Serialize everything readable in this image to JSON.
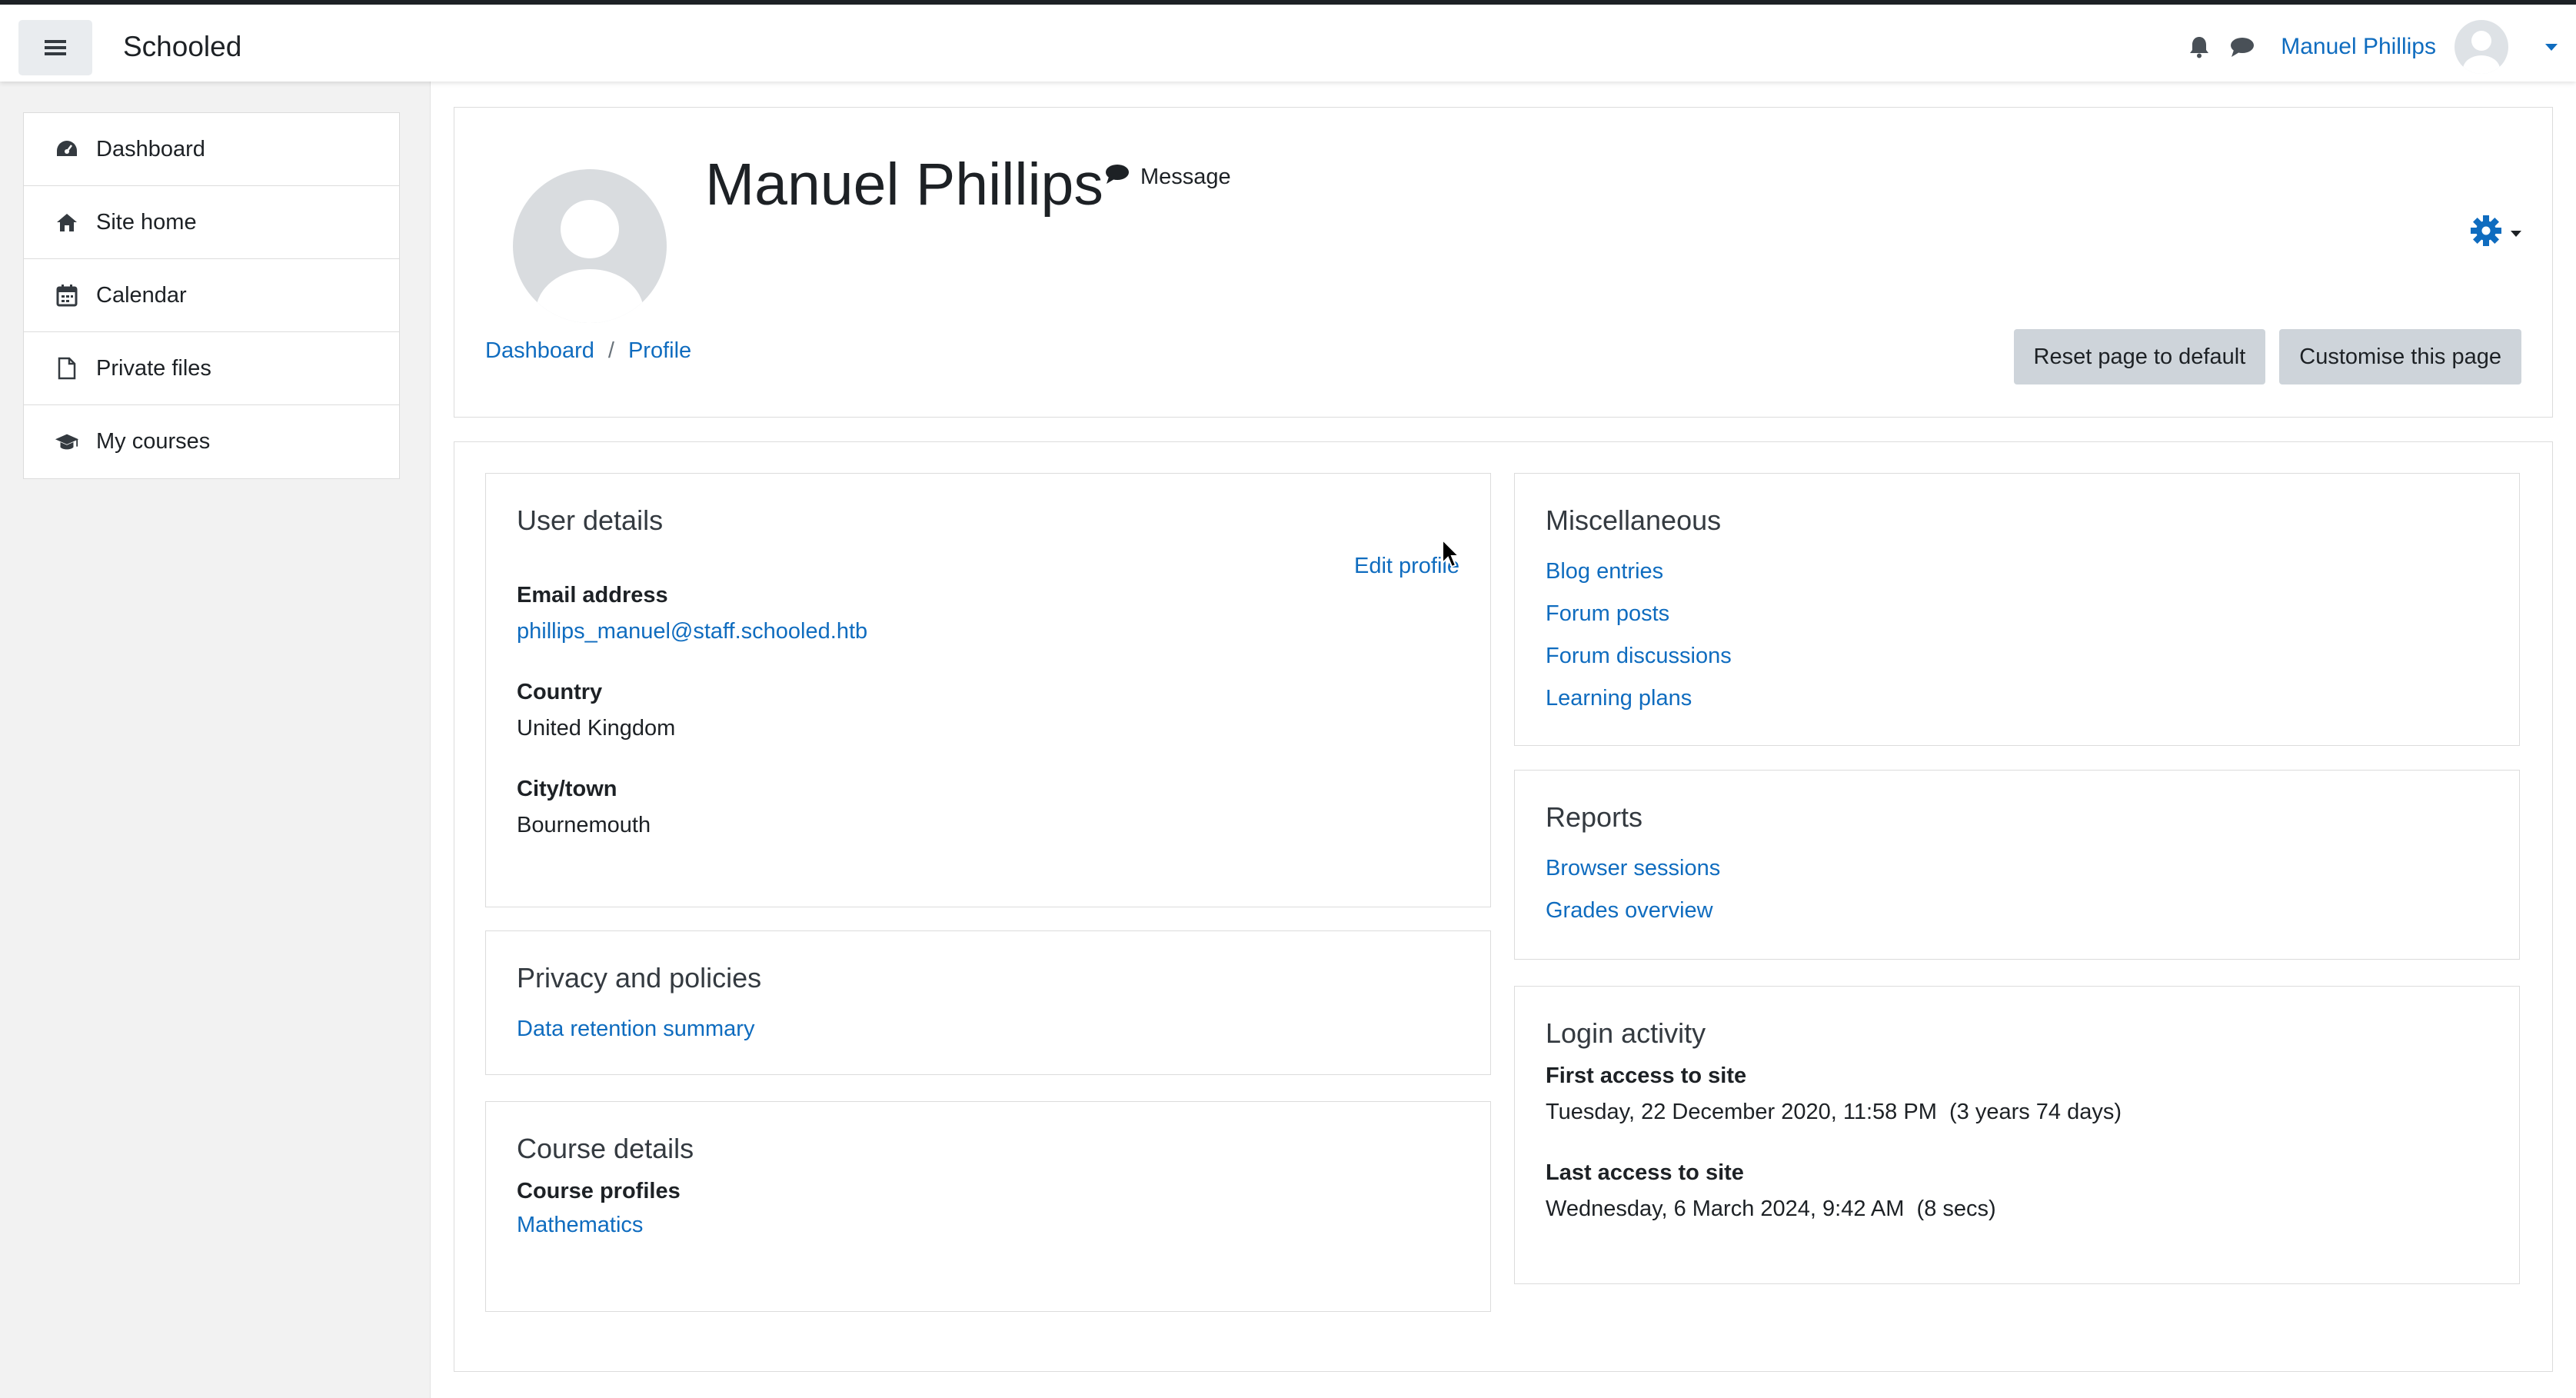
{
  "navbar": {
    "brand": "Schooled",
    "user_name": "Manuel Phillips",
    "icons": [
      "hamburger-icon",
      "bell-icon",
      "chat-icon",
      "avatar",
      "caret-down-icon"
    ]
  },
  "drawer": {
    "items": [
      {
        "label": "Dashboard",
        "icon": "dashboard-icon"
      },
      {
        "label": "Site home",
        "icon": "home-icon"
      },
      {
        "label": "Calendar",
        "icon": "calendar-icon"
      },
      {
        "label": "Private files",
        "icon": "file-icon"
      },
      {
        "label": "My courses",
        "icon": "graduation-cap-icon"
      }
    ]
  },
  "header": {
    "name": "Manuel Phillips",
    "message_label": "Message",
    "breadcrumb": [
      "Dashboard",
      "Profile"
    ],
    "breadcrumb_separator": "/",
    "reset_button": "Reset page to default",
    "customise_button": "Customise this page"
  },
  "user_details": {
    "title": "User details",
    "edit_profile": "Edit profile",
    "email_label": "Email address",
    "email_value": "phillips_manuel@staff.schooled.htb",
    "country_label": "Country",
    "country_value": "United Kingdom",
    "city_label": "City/town",
    "city_value": "Bournemouth"
  },
  "privacy": {
    "title": "Privacy and policies",
    "link": "Data retention summary"
  },
  "course_details": {
    "title": "Course details",
    "profiles_label": "Course profiles",
    "course": "Mathematics"
  },
  "miscellaneous": {
    "title": "Miscellaneous",
    "links": [
      "Blog entries",
      "Forum posts",
      "Forum discussions",
      "Learning plans"
    ]
  },
  "reports": {
    "title": "Reports",
    "links": [
      "Browser sessions",
      "Grades overview"
    ]
  },
  "login_activity": {
    "title": "Login activity",
    "first_label": "First access to site",
    "first_value": "Tuesday, 22 December 2020, 11:58 PM  (3 years 74 days)",
    "last_label": "Last access to site",
    "last_value": "Wednesday, 6 March 2024, 9:42 AM  (8 secs)"
  },
  "colors": {
    "link": "#0f6cbf",
    "text": "#1d2125",
    "button_bg": "#ced4da",
    "page_bg": "#f2f2f2"
  }
}
